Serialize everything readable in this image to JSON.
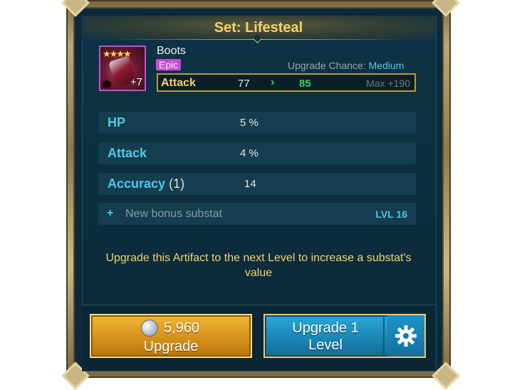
{
  "panel": {
    "title": "Set: Lifesteal"
  },
  "item": {
    "name": "Boots",
    "rarity": "Epic",
    "level_badge": "+7",
    "stars": "★★★★",
    "upgrade_chance_label": "Upgrade Chance:",
    "upgrade_chance_value": "Medium",
    "rarity_color": "#c24fd3"
  },
  "main_stat": {
    "label": "Attack",
    "current": "77",
    "next": "85",
    "max": "Max +190"
  },
  "substats": [
    {
      "name": "HP",
      "rolls": "",
      "value": "5 %"
    },
    {
      "name": "Attack",
      "rolls": "",
      "value": "4 %"
    },
    {
      "name": "Accuracy",
      "rolls": "(1)",
      "value": "14"
    }
  ],
  "bonus_substat": {
    "label": "New bonus substat",
    "level": "LVL 16"
  },
  "hint": "Upgrade this Artifact to the next Level to increase a substat's value",
  "buttons": {
    "upgrade_cost": "5,960",
    "upgrade_label": "Upgrade",
    "upgrade_level_line1": "Upgrade 1",
    "upgrade_level_line2": "Level"
  },
  "icons": {
    "coin": "silver-coin-icon",
    "gear": "gear-icon",
    "arrow": "chevron-right-icon"
  },
  "colors": {
    "title": "#f2d36b",
    "substat_name": "#4fc8e8",
    "upgrade_green": "#3ad05a",
    "gold_button": "#d6921b",
    "blue_button": "#1a86b6"
  }
}
